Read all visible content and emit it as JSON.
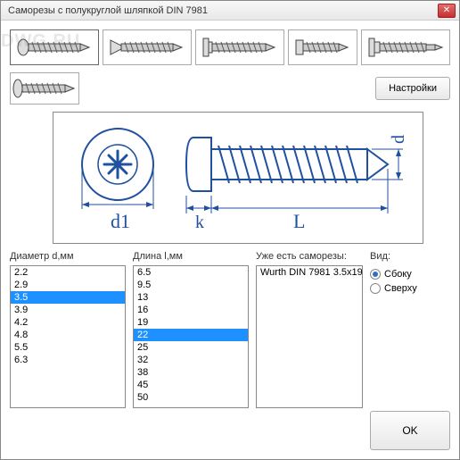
{
  "window": {
    "title": "Саморезы с полукруглой шляпкой DIN 7981"
  },
  "watermark": "DWG.RU",
  "toolbar_row1": {
    "thumbs": [
      "pan-head",
      "countersunk",
      "hex-washer",
      "cylinder",
      "flange-drill"
    ]
  },
  "toolbar_row2": {
    "thumb": "washer-head",
    "settings_label": "Настройки"
  },
  "diagram": {
    "labels": {
      "d1": "d1",
      "k": "k",
      "L": "L",
      "d": "d"
    }
  },
  "columns": {
    "diameter": {
      "label": "Диаметр d,мм",
      "items": [
        "2.2",
        "2.9",
        "3.5",
        "3.9",
        "4.2",
        "4.8",
        "5.5",
        "6.3"
      ],
      "selected": "3.5"
    },
    "length": {
      "label": "Длина l,мм",
      "items": [
        "6.5",
        "9.5",
        "13",
        "16",
        "19",
        "22",
        "25",
        "32",
        "38",
        "45",
        "50"
      ],
      "selected": "22"
    },
    "existing": {
      "label": "Уже есть саморезы:",
      "items": [
        "Wurth DIN 7981 3.5x19"
      ]
    }
  },
  "view": {
    "label": "Вид:",
    "options": {
      "side": "Сбоку",
      "top": "Сверху"
    },
    "selected": "side"
  },
  "ok_label": "OK"
}
